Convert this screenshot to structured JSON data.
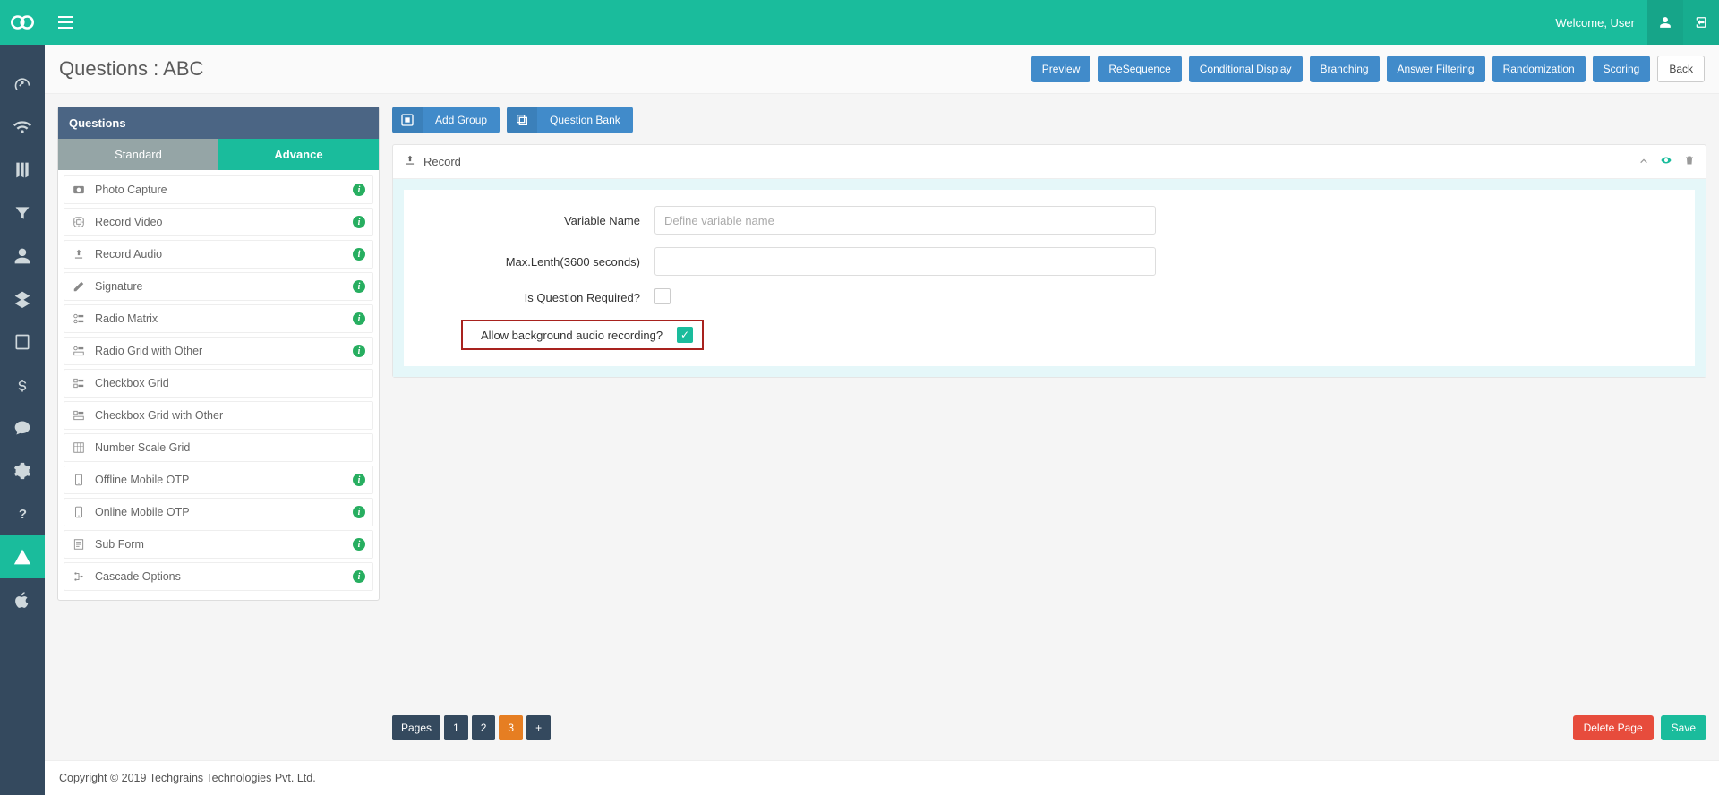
{
  "header": {
    "welcome": "Welcome, User"
  },
  "page": {
    "title": "Questions : ABC"
  },
  "actions": {
    "preview": "Preview",
    "resequence": "ReSequence",
    "conditional": "Conditional Display",
    "branching": "Branching",
    "filtering": "Answer Filtering",
    "randomization": "Randomization",
    "scoring": "Scoring",
    "back": "Back"
  },
  "sidebar": {
    "heading": "Questions",
    "tab_standard": "Standard",
    "tab_advance": "Advance",
    "items": [
      {
        "label": "Photo Capture",
        "info": true
      },
      {
        "label": "Record Video",
        "info": true
      },
      {
        "label": "Record Audio",
        "info": true
      },
      {
        "label": "Signature",
        "info": true
      },
      {
        "label": "Radio Matrix",
        "info": true
      },
      {
        "label": "Radio Grid with Other",
        "info": true
      },
      {
        "label": "Checkbox Grid",
        "info": false
      },
      {
        "label": "Checkbox Grid with Other",
        "info": false
      },
      {
        "label": "Number Scale Grid",
        "info": false
      },
      {
        "label": "Offline Mobile OTP",
        "info": true
      },
      {
        "label": "Online Mobile OTP",
        "info": true
      },
      {
        "label": "Sub Form",
        "info": true
      },
      {
        "label": "Cascade Options",
        "info": true
      }
    ]
  },
  "toolbar": {
    "add_group": "Add Group",
    "question_bank": "Question Bank"
  },
  "record_card": {
    "title": "Record",
    "fields": {
      "variable_name": "Variable Name",
      "variable_placeholder": "Define variable name",
      "max_length": "Max.Lenth(3600 seconds)",
      "required": "Is Question Required?",
      "allow_bg": "Allow background audio recording?"
    }
  },
  "pager": {
    "label": "Pages",
    "pages": [
      "1",
      "2",
      "3"
    ]
  },
  "footer_actions": {
    "delete": "Delete Page",
    "save": "Save"
  },
  "footer": "Copyright © 2019 Techgrains Technologies Pvt. Ltd."
}
